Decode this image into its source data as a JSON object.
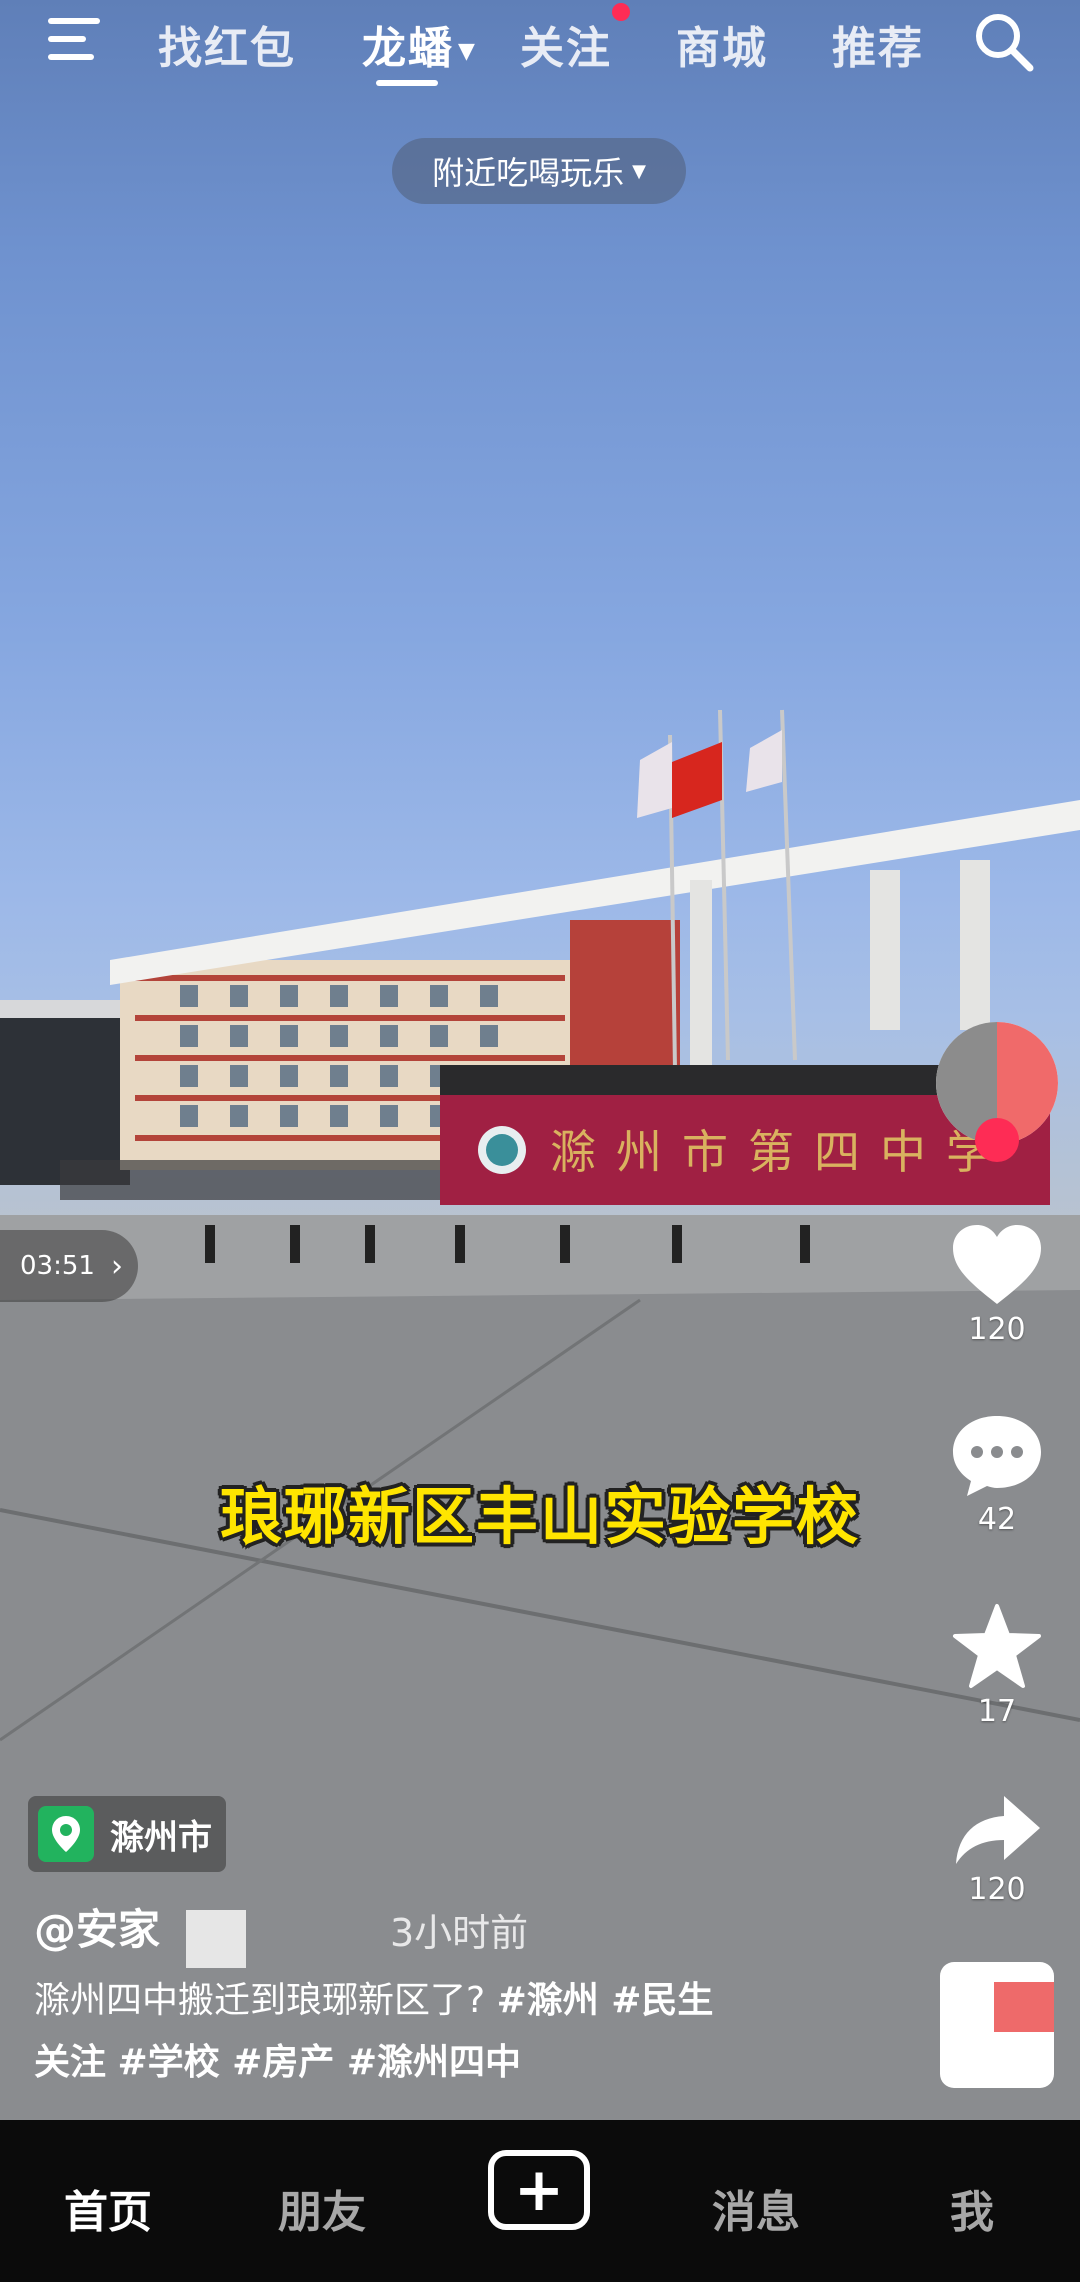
{
  "top_tabs": [
    "找红包",
    "龙蟠",
    "关注",
    "商城",
    "推荐"
  ],
  "nearby_label": "附近吃喝玩乐",
  "video": {
    "duration": "03:51",
    "subtitle": "琅琊新区丰山实验学校",
    "school_sign": "滁州市第四中学"
  },
  "actions": {
    "likes": "120",
    "comments": "42",
    "favorites": "17",
    "shares": "120"
  },
  "post": {
    "location": "滁州市",
    "author": "@安家",
    "time_ago": "3小时前",
    "description": "滁州四中搬迁到琅琊新区了?",
    "hashtags_line1": "#滁州  #民生",
    "hashtags_line2_prefix": "关注",
    "hashtags_line2": "#学校  #房产  #滁州四中"
  },
  "bottom_nav": {
    "home": "首页",
    "friends": "朋友",
    "messages": "消息",
    "me": "我"
  },
  "colors": {
    "accent": "#fe2c55",
    "subtitle": "#ffe500"
  }
}
